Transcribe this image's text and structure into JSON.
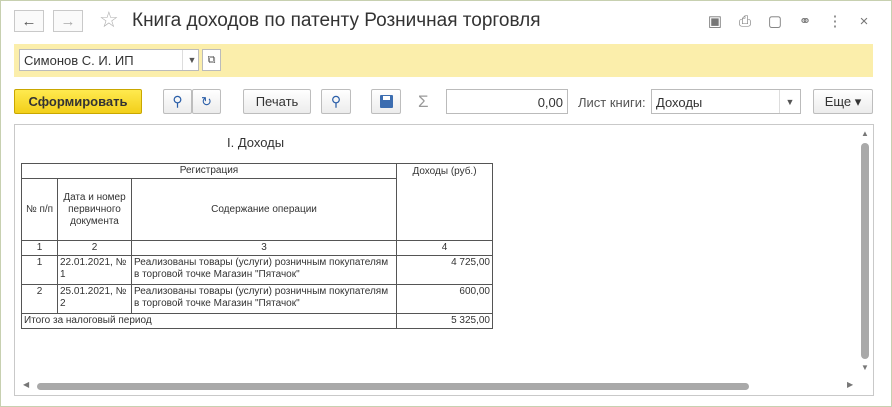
{
  "window": {
    "title": "Книга доходов по патенту Розничная торговля",
    "back_icon": "←",
    "forward_icon": "→",
    "favorite_icon": "☆",
    "toolbar_icons": {
      "save": "▣",
      "print": "⎙",
      "preview": "▢",
      "link": "⚭",
      "more": "⋮",
      "close": "×"
    }
  },
  "organization": {
    "value": "Симонов С. И. ИП",
    "dropdown_icon": "▼",
    "open_icon": "⧉"
  },
  "commands": {
    "generate": "Сформировать",
    "find_icon": "🔍",
    "find_next_icon": "↻",
    "print": "Печать",
    "preview_icon": "🔍",
    "save_icon": "💾",
    "sigma": "Σ",
    "sum_value": "0,00",
    "sheet_label": "Лист книги:",
    "sheet_value": "Доходы",
    "sheet_dropdown_icon": "▼",
    "more": "Еще ▾"
  },
  "report": {
    "section_title": "I. Доходы",
    "header": {
      "registration": "Регистрация",
      "income": "Доходы (руб.)",
      "num": "№ п/п",
      "date_doc": "Дата и номер первичного документа",
      "content": "Содержание операции",
      "col1": "1",
      "col2": "2",
      "col3": "3",
      "col4": "4"
    },
    "rows": [
      {
        "num": "1",
        "date_doc": "22.01.2021, № 1",
        "content": "Реализованы товары (услуги) розничным покупателям в торговой точке Магазин \"Пятачок\"",
        "income": "4 725,00"
      },
      {
        "num": "2",
        "date_doc": "25.01.2021, № 2",
        "content": "Реализованы товары (услуги) розничным покупателям в торговой точке Магазин \"Пятачок\"",
        "income": "600,00"
      }
    ],
    "total_label": "Итого за налоговый период",
    "total_value": "5 325,00"
  },
  "scroll": {
    "up": "▲",
    "down": "▼",
    "left": "◀",
    "right": "▶"
  }
}
